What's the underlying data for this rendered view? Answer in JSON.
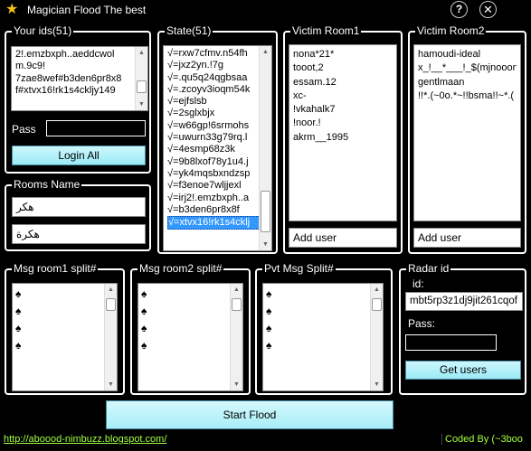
{
  "window": {
    "title": "Magician Flood The best",
    "help_label": "?",
    "close_label": "✕"
  },
  "ids_group": {
    "title": "Your ids(51)",
    "items": [
      "2!.emzbxph..aeddcwol",
      "m.9c9!",
      "7zae8wef#b3den6pr8x8",
      "f#xtvx16!rk1s4ckljy149"
    ],
    "pass_label": "Pass",
    "login_label": "Login All"
  },
  "state_group": {
    "title": "State(51)",
    "items": [
      "√=rxw7cfmv.n54fh",
      "√=jxz2yn.!7g",
      "√=.qu5q24qgbsaa",
      "√=.zcoyv3ioqm54k",
      "√=ejfslsb",
      "√=2sglxbjx",
      "√=w66gp!6srmohs",
      "√=uwurn33g79rq.l",
      "√=4esmp68z3k",
      "√=9b8lxof78y1u4.j",
      "√=yk4mqsbxndzsp",
      "√=f3enoe7wljjexl",
      "√=irj2!.emzbxph..a",
      "√=b3den6pr8x8f",
      "√=xtvx16!rk1s4cklj"
    ]
  },
  "victim_room1": {
    "title": "Victim Room1",
    "items": [
      "nona*21*",
      "tooot,2",
      "essam.12",
      "xc-",
      "!vkahalk7",
      "!noor.!",
      "akrm__1995"
    ],
    "add_label": "Add user"
  },
  "victim_room2": {
    "title": "Victim Room2",
    "items": [
      "hamoudi-ideal",
      "x_!__*___!_$(mjnooon",
      "gentlmaan",
      "!!*.(~0o.*~!!bsma!!~*.("
    ],
    "add_label": "Add user"
  },
  "rooms_group": {
    "title": "Rooms Name",
    "room1": "هكر",
    "room2": "هكرة"
  },
  "msg_room1": {
    "title": "Msg room1 split#",
    "glyph": "♠"
  },
  "msg_room2": {
    "title": "Msg room2 split#",
    "glyph": "♠"
  },
  "pvt_msg": {
    "title": "Pvt Msg Split#",
    "glyph": "♠"
  },
  "radar_group": {
    "title": "Radar id",
    "id_label": "id:",
    "id_value": "mbt5rp3z1dj9jit261cqof",
    "pass_label": "Pass:",
    "get_users_label": "Get users"
  },
  "start_label": "Start Flood",
  "footer": {
    "link": "http://aboood-nimbuzz.blogspot.com/",
    "credit": "Coded By (~3boo"
  },
  "colors": {
    "accent_button": "#b2f0fa",
    "selection": "#3399ff",
    "footer_text": "#a0ff40"
  }
}
